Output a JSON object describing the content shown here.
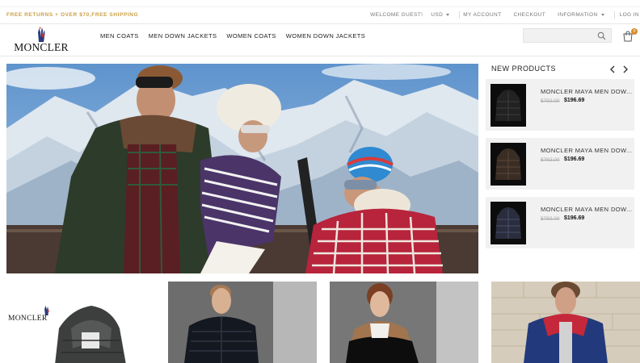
{
  "topbar": {
    "promo": "FREE RETURNS + OVER $70,FREE SHIPPING",
    "welcome": "WELCOME GUEST!",
    "currency": "USD",
    "my_account": "MY ACCOUNT",
    "checkout": "CHECKOUT",
    "information": "INFORMATION",
    "login": "LOG IN"
  },
  "header": {
    "logo_text": "MONCLER",
    "nav": [
      "MEN COATS",
      "MEN DOWN JACKETS",
      "WOMEN COATS",
      "WOMEN DOWN JACKETS"
    ],
    "search_placeholder": "",
    "cart_count": "0"
  },
  "new_products": {
    "title": "NEW PRODUCTS",
    "items": [
      {
        "name": "MONCLER MAYA MEN DOW...",
        "old_price": "$792.00",
        "price": "$196.69"
      },
      {
        "name": "MONCLER MAYA MEN DOW...",
        "old_price": "$792.00",
        "price": "$196.69"
      },
      {
        "name": "MONCLER MAYA MEN DOW...",
        "old_price": "$792.00",
        "price": "$196.69"
      }
    ]
  },
  "tiles": {
    "logo_text": "MONCLER"
  },
  "colors": {
    "promo": "#c9a046",
    "badge": "#d88b2c",
    "card_bg": "#f1f1f1"
  },
  "icons": {
    "search": "search-icon",
    "cart": "cart-icon",
    "prev": "chevron-left-icon",
    "next": "chevron-right-icon"
  }
}
